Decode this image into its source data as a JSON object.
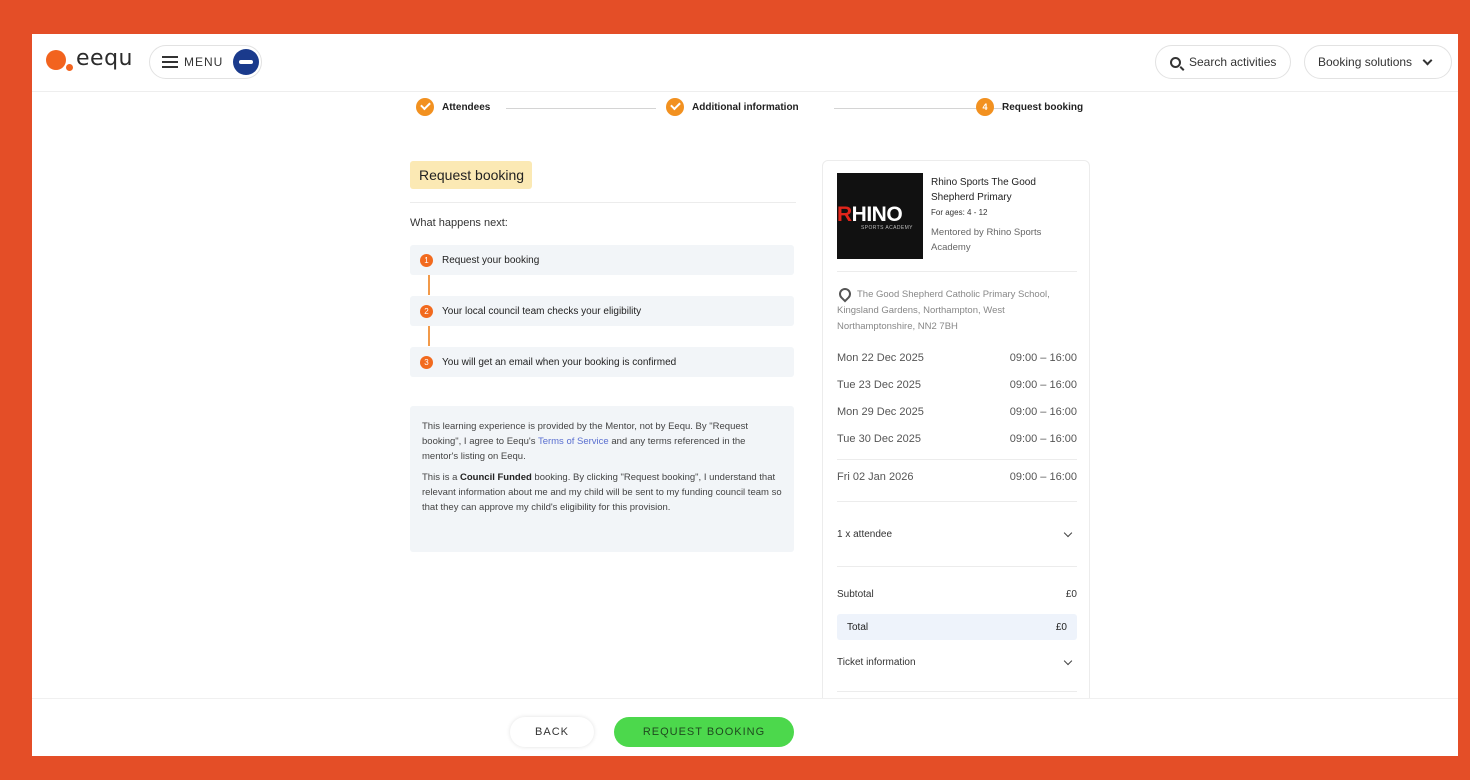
{
  "header": {
    "logo_text": "eequ",
    "menu_label": "MENU",
    "search_label": "Search activities",
    "solutions_label": "Booking solutions"
  },
  "stepper": {
    "steps": [
      {
        "label": "Attendees",
        "state": "done",
        "number": ""
      },
      {
        "label": "Additional information",
        "state": "done",
        "number": ""
      },
      {
        "label": "Request booking",
        "state": "current",
        "number": "4"
      }
    ]
  },
  "main": {
    "title": "Request booking",
    "next_label": "What happens next:",
    "next_steps": [
      {
        "number": "1",
        "text": "Request your booking"
      },
      {
        "number": "2",
        "text": "Your local council team checks your eligibility"
      },
      {
        "number": "3",
        "text": "You will get an email when your booking is confirmed"
      }
    ],
    "terms": {
      "p1_before": "This learning experience is provided by the Mentor, not by Eequ. By \"Request booking\", I agree to Eequ's ",
      "p1_link": "Terms of Service",
      "p1_after": " and any terms referenced in the mentor's listing on Eequ.",
      "p2_before": "This is a ",
      "p2_strong": "Council Funded",
      "p2_after": " booking. By clicking \"Request booking\", I understand that relevant information about me and my child will be sent to my funding council team so that they can approve my child's eligibility for this provision."
    }
  },
  "summary": {
    "image_text_r": "R",
    "image_text_rest": "HINO",
    "image_subtext": "SPORTS ACADEMY",
    "activity_title": "Rhino Sports The Good Shepherd Primary",
    "ages": "For ages: 4 - 12",
    "mentor": "Mentored by Rhino Sports Academy",
    "address": "The Good Shepherd Catholic Primary School, Kingsland Gardens, Northampton, West Northamptonshire, NN2 7BH",
    "dates": [
      {
        "date": "Mon 22 Dec 2025",
        "time": "09:00 – 16:00"
      },
      {
        "date": "Tue 23 Dec 2025",
        "time": "09:00 – 16:00"
      },
      {
        "date": "Mon 29 Dec 2025",
        "time": "09:00 – 16:00"
      },
      {
        "date": "Tue 30 Dec 2025",
        "time": "09:00 – 16:00"
      },
      {
        "date": "Fri 02 Jan 2026",
        "time": "09:00 – 16:00"
      }
    ],
    "attendees": "1 x attendee",
    "subtotal_label": "Subtotal",
    "subtotal_value": "£0",
    "total_label": "Total",
    "total_value": "£0",
    "ticket_info": "Ticket information"
  },
  "footer": {
    "back_label": "BACK",
    "request_label": "REQUEST BOOKING"
  },
  "colors": {
    "border": "#e44e27",
    "accent_orange": "#f29120",
    "badge": "#fbe9b4",
    "cta_green": "#4cd84c"
  }
}
